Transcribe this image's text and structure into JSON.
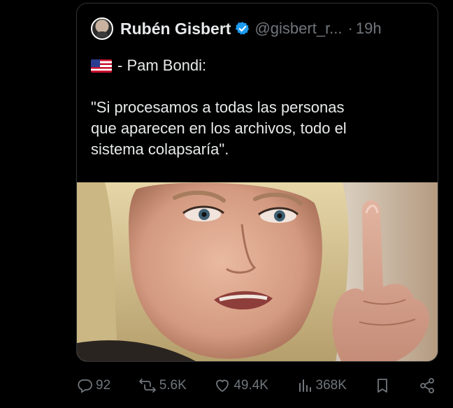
{
  "post": {
    "author_name": "Rubén Gisbert",
    "handle": "@gisbert_r...",
    "separator": "·",
    "time": "19h",
    "flag_icon": "us-flag-icon",
    "line1": "- Pam Bondi:",
    "line2": "\"Si procesamos a todas las personas",
    "line3": "que aparecen en los archivos, todo el",
    "line4": "sistema colapsaría\"."
  },
  "actions": {
    "replies": "92",
    "reposts": "5.6K",
    "likes": "49.4K",
    "views": "368K"
  },
  "colors": {
    "background": "#000000",
    "text": "#e7e9ea",
    "muted": "#71767b",
    "verified": "#1d9bf0",
    "border": "#2f3336"
  }
}
